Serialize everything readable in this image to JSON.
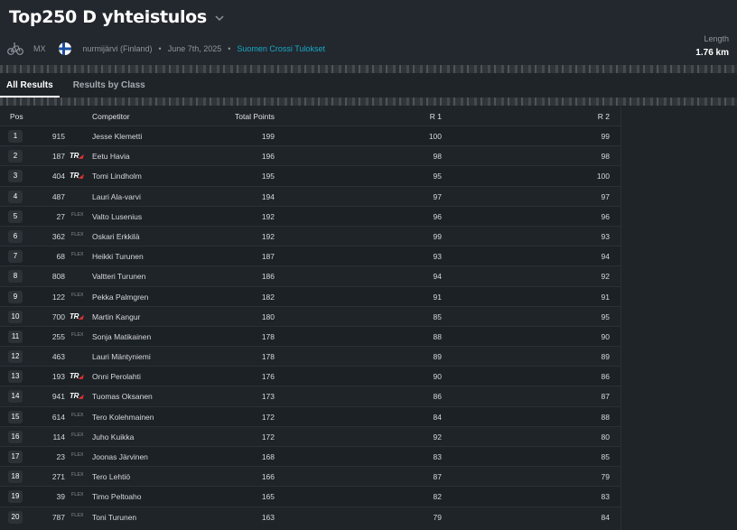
{
  "header": {
    "title": "Top250 D yhteistulos",
    "sport": "MX",
    "location": "nurmijärvi (Finland)",
    "date": "June 7th, 2025",
    "organizer": "Suomen Crossi Tulokset",
    "length_label": "Length",
    "length_value": "1.76 km",
    "separator": "•"
  },
  "tabs": [
    {
      "label": "All Results",
      "active": true
    },
    {
      "label": "Results by Class",
      "active": false
    }
  ],
  "table": {
    "columns": {
      "pos": "Pos",
      "competitor": "Competitor",
      "total": "Total Points",
      "r1": "R 1",
      "r2": "R 2"
    },
    "rows": [
      {
        "pos": "1",
        "num": "915",
        "tag": "",
        "name": "Jesse Klemetti",
        "total": "199",
        "r1": "100",
        "r2": "99"
      },
      {
        "pos": "2",
        "num": "187",
        "tag": "TR",
        "name": "Eetu Havia",
        "total": "196",
        "r1": "98",
        "r2": "98"
      },
      {
        "pos": "3",
        "num": "404",
        "tag": "TR",
        "name": "Tomi Lindholm",
        "total": "195",
        "r1": "95",
        "r2": "100"
      },
      {
        "pos": "4",
        "num": "487",
        "tag": "",
        "name": "Lauri Ala-varvi",
        "total": "194",
        "r1": "97",
        "r2": "97"
      },
      {
        "pos": "5",
        "num": "27",
        "tag": "FLEX",
        "name": "Valto Lusenius",
        "total": "192",
        "r1": "96",
        "r2": "96"
      },
      {
        "pos": "6",
        "num": "362",
        "tag": "FLEX",
        "name": "Oskari Erkkilä",
        "total": "192",
        "r1": "99",
        "r2": "93"
      },
      {
        "pos": "7",
        "num": "68",
        "tag": "FLEX",
        "name": "Heikki Turunen",
        "total": "187",
        "r1": "93",
        "r2": "94"
      },
      {
        "pos": "8",
        "num": "808",
        "tag": "",
        "name": "Valtteri Turunen",
        "total": "186",
        "r1": "94",
        "r2": "92"
      },
      {
        "pos": "9",
        "num": "122",
        "tag": "FLEX",
        "name": "Pekka Palmgren",
        "total": "182",
        "r1": "91",
        "r2": "91"
      },
      {
        "pos": "10",
        "num": "700",
        "tag": "TR",
        "name": "Martin Kangur",
        "total": "180",
        "r1": "85",
        "r2": "95"
      },
      {
        "pos": "11",
        "num": "255",
        "tag": "FLEX",
        "name": "Sonja Matikainen",
        "total": "178",
        "r1": "88",
        "r2": "90"
      },
      {
        "pos": "12",
        "num": "463",
        "tag": "",
        "name": "Lauri Mäntyniemi",
        "total": "178",
        "r1": "89",
        "r2": "89"
      },
      {
        "pos": "13",
        "num": "193",
        "tag": "TR",
        "name": "Onni Perolahti",
        "total": "176",
        "r1": "90",
        "r2": "86"
      },
      {
        "pos": "14",
        "num": "941",
        "tag": "TR",
        "name": "Tuomas Oksanen",
        "total": "173",
        "r1": "86",
        "r2": "87"
      },
      {
        "pos": "15",
        "num": "614",
        "tag": "FLEX",
        "name": "Tero Kolehmainen",
        "total": "172",
        "r1": "84",
        "r2": "88"
      },
      {
        "pos": "16",
        "num": "114",
        "tag": "FLEX",
        "name": "Juho Kuikka",
        "total": "172",
        "r1": "92",
        "r2": "80"
      },
      {
        "pos": "17",
        "num": "23",
        "tag": "FLEX",
        "name": "Joonas Järvinen",
        "total": "168",
        "r1": "83",
        "r2": "85"
      },
      {
        "pos": "18",
        "num": "271",
        "tag": "FLEX",
        "name": "Tero Lehtiö",
        "total": "166",
        "r1": "87",
        "r2": "79"
      },
      {
        "pos": "19",
        "num": "39",
        "tag": "FLEX",
        "name": "Timo Peltoaho",
        "total": "165",
        "r1": "82",
        "r2": "83"
      },
      {
        "pos": "20",
        "num": "787",
        "tag": "FLEX",
        "name": "Toni Turunen",
        "total": "163",
        "r1": "79",
        "r2": "84"
      }
    ]
  },
  "colors": {
    "background": "#1f2429",
    "link": "#18a8c9",
    "tr_accent": "#e0312e"
  },
  "icons": {
    "sport": "bicycle-icon",
    "flag": "finland-flag-icon",
    "title_menu": "chevron-down-icon"
  }
}
